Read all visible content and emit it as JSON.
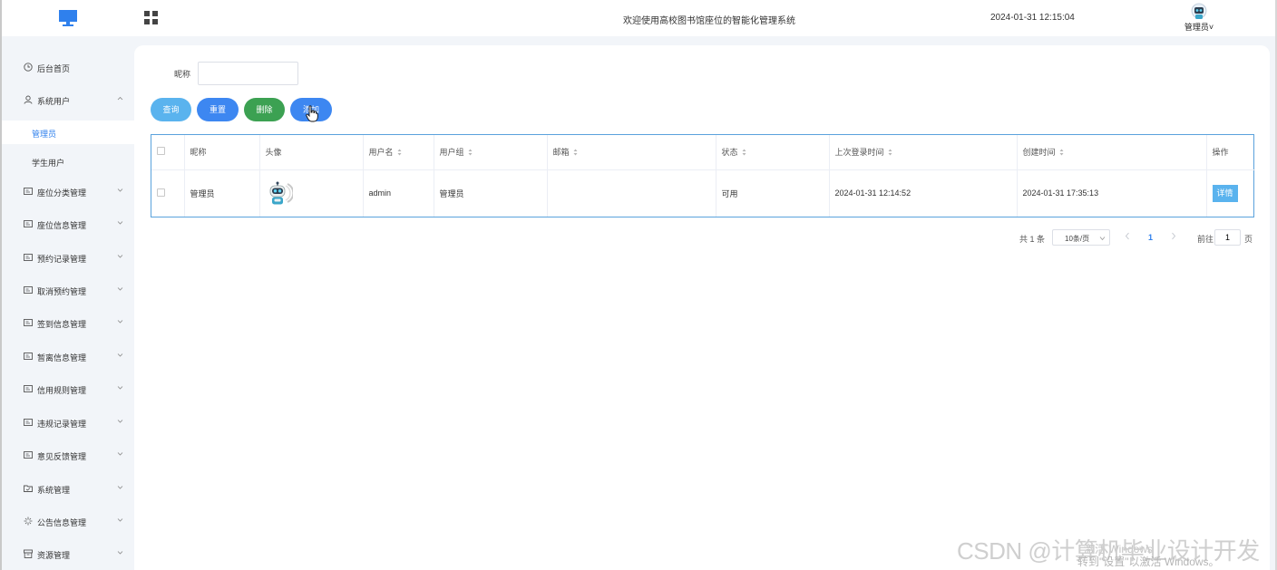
{
  "header": {
    "title": "欢迎使用高校图书馆座位的智能化管理系统",
    "datetime": "2024-01-31 12:15:04",
    "user_name": "管理员",
    "user_caret": "˅"
  },
  "sidebar": {
    "items": [
      {
        "label": "后台首页",
        "icon": "clock-icon",
        "expandable": false
      },
      {
        "label": "系统用户",
        "icon": "user-icon",
        "expandable": true,
        "expanded": true,
        "children": [
          {
            "label": "管理员",
            "active": true
          },
          {
            "label": "学生用户",
            "active": false
          }
        ]
      },
      {
        "label": "座位分类管理",
        "icon": "card-icon",
        "expandable": true
      },
      {
        "label": "座位信息管理",
        "icon": "card-icon",
        "expandable": true
      },
      {
        "label": "预约记录管理",
        "icon": "card-icon",
        "expandable": true
      },
      {
        "label": "取消预约管理",
        "icon": "card-icon",
        "expandable": true
      },
      {
        "label": "签到信息管理",
        "icon": "card-icon",
        "expandable": true
      },
      {
        "label": "暂离信息管理",
        "icon": "card-icon",
        "expandable": true
      },
      {
        "label": "信用规则管理",
        "icon": "card-icon",
        "expandable": true
      },
      {
        "label": "违规记录管理",
        "icon": "card-icon",
        "expandable": true
      },
      {
        "label": "意见反馈管理",
        "icon": "card-icon",
        "expandable": true
      },
      {
        "label": "系统管理",
        "icon": "folder-icon",
        "expandable": true
      },
      {
        "label": "公告信息管理",
        "icon": "sparkle-icon",
        "expandable": true
      },
      {
        "label": "资源管理",
        "icon": "archive-icon",
        "expandable": true
      }
    ]
  },
  "filter": {
    "label": "昵称",
    "value": "",
    "placeholder": ""
  },
  "toolbar": {
    "query": "查询",
    "reset": "重置",
    "delete": "删除",
    "add": "添加",
    "add_visible": "添加"
  },
  "table": {
    "columns": [
      "昵称",
      "头像",
      "用户名",
      "用户组",
      "邮箱",
      "状态",
      "上次登录时间",
      "创建时间",
      "操作"
    ],
    "rows": [
      {
        "nickname": "管理员",
        "avatar": "robot-avatar",
        "username": "admin",
        "group": "管理员",
        "email": "",
        "status": "可用",
        "last_login": "2024-01-31 12:14:52",
        "created": "2024-01-31 17:35:13",
        "action": "详情"
      }
    ]
  },
  "pagination": {
    "total": "共 1 条",
    "page_size": "10条/页",
    "current_page": "1",
    "goto_label": "前往",
    "goto_value": "1",
    "page_suffix": "页"
  },
  "watermarks": {
    "csdn": "CSDN @计算机毕业设计开发",
    "activate": "转到\"设置\"以激活 Windows。",
    "activate_title": "激活 Windows"
  },
  "colors": {
    "accent": "#3d87f1",
    "query": "#5ab3ee",
    "delete": "#3ca152",
    "sidebar_bg": "#f2f5f9",
    "table_border": "#5aa2dc"
  }
}
